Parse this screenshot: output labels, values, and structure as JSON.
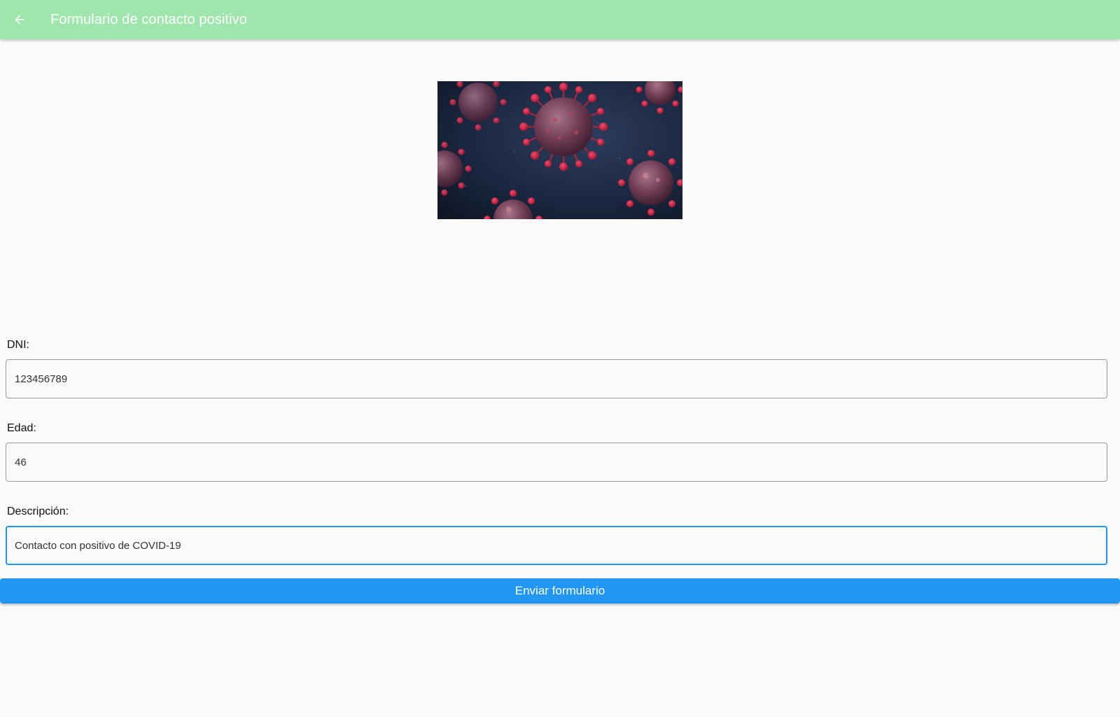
{
  "appbar": {
    "title": "Formulario de contacto positivo",
    "back_icon": "arrow-back-icon",
    "background": "#9ee6ac"
  },
  "hero": {
    "icon": "coronavirus-illustration"
  },
  "form": {
    "dni": {
      "label": "DNI:",
      "value": "123456789"
    },
    "edad": {
      "label": "Edad:",
      "value": "46"
    },
    "descripcion": {
      "label": "Descripción:",
      "value": "Contacto con positivo de COVID-19"
    },
    "submit_label": "Enviar formulario"
  },
  "colors": {
    "accent": "#2196f3",
    "appbar": "#9ee6ac"
  }
}
